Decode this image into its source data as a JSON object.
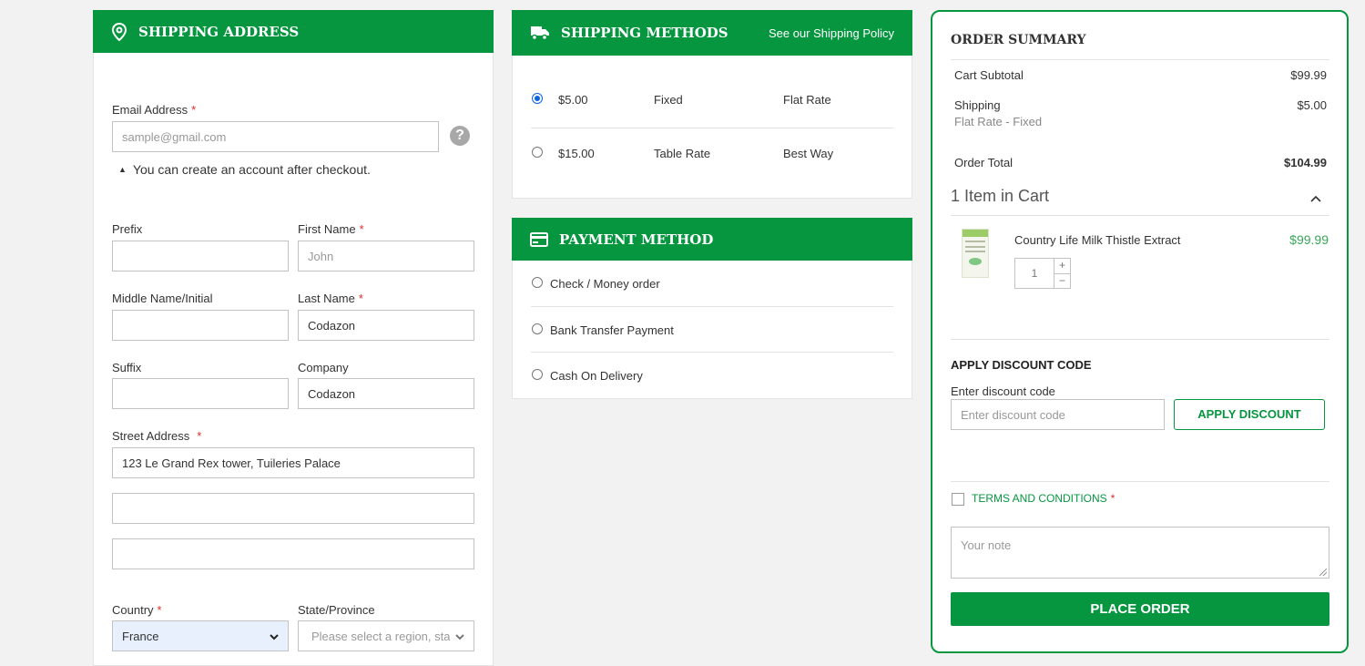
{
  "shipping_address": {
    "title": "SHIPPING ADDRESS",
    "email_label": "Email Address",
    "email_placeholder": "sample@gmail.com",
    "account_note": "You can create an account after checkout.",
    "prefix_label": "Prefix",
    "first_name_label": "First Name",
    "first_name_placeholder": "John",
    "middle_name_label": "Middle Name/Initial",
    "last_name_label": "Last Name",
    "last_name_value": "Codazon",
    "suffix_label": "Suffix",
    "company_label": "Company",
    "company_value": "Codazon",
    "street_label": "Street Address",
    "street_value": "123 Le Grand Rex tower, Tuileries Palace",
    "country_label": "Country",
    "country_value": "France",
    "state_label": "State/Province",
    "state_placeholder": "Please select a region, state or province."
  },
  "shipping_methods": {
    "title": "SHIPPING METHODS",
    "policy_link": "See our Shipping Policy",
    "options": [
      {
        "price": "$5.00",
        "method": "Fixed",
        "carrier": "Flat Rate",
        "selected": true
      },
      {
        "price": "$15.00",
        "method": "Table Rate",
        "carrier": "Best Way",
        "selected": false
      }
    ]
  },
  "payment_method": {
    "title": "PAYMENT METHOD",
    "options": [
      "Check / Money order",
      "Bank Transfer Payment",
      "Cash On Delivery"
    ]
  },
  "order_summary": {
    "title": "ORDER SUMMARY",
    "subtotal_label": "Cart Subtotal",
    "subtotal_value": "$99.99",
    "shipping_label": "Shipping",
    "shipping_value": "$5.00",
    "shipping_method": "Flat Rate - Fixed",
    "total_label": "Order Total",
    "total_value": "$104.99",
    "items_in_cart": "1 Item in Cart",
    "item": {
      "name": "Country Life Milk Thistle Extract",
      "price": "$99.99",
      "qty": "1"
    },
    "discount_title": "APPLY DISCOUNT CODE",
    "discount_label": "Enter discount code",
    "discount_placeholder": "Enter discount code",
    "apply_button": "APPLY DISCOUNT",
    "terms_label": "TERMS AND CONDITIONS",
    "note_placeholder": "Your note",
    "place_order": "PLACE ORDER"
  },
  "colors": {
    "brand_green": "#05963f",
    "required_red": "#e02b27",
    "price_green": "#3aa65a"
  }
}
